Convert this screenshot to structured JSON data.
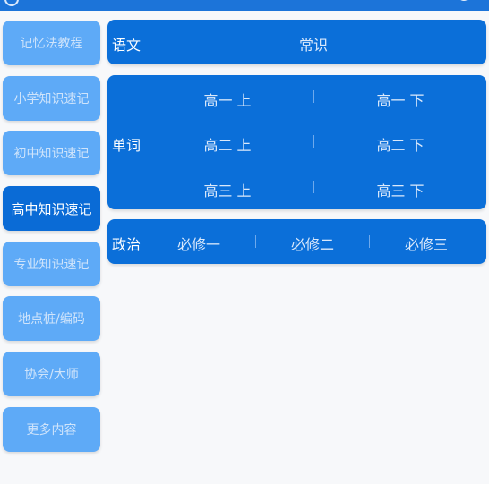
{
  "sidebar": {
    "items": [
      {
        "label": "记忆法教程"
      },
      {
        "label": "小学知识速记"
      },
      {
        "label": "初中知识速记"
      },
      {
        "label": "高中知识速记"
      },
      {
        "label": "专业知识速记"
      },
      {
        "label": "地点桩/编码"
      },
      {
        "label": "协会/大师"
      },
      {
        "label": "更多内容"
      }
    ],
    "active_index": 3
  },
  "cards": {
    "chinese": {
      "label": "语文",
      "items": [
        "常识"
      ]
    },
    "words": {
      "label": "单词",
      "items": [
        "高一 上",
        "高一 下",
        "高二 上",
        "高二 下",
        "高三 上",
        "高三 下"
      ]
    },
    "politics": {
      "label": "政治",
      "items": [
        "必修一",
        "必修二",
        "必修三"
      ]
    }
  },
  "colors": {
    "header": "#1c74d9",
    "card": "#0b6fd9",
    "sidebar_button": "#5eaaf7",
    "sidebar_button_active": "#0a6bd6",
    "background": "#f7f8fa"
  }
}
